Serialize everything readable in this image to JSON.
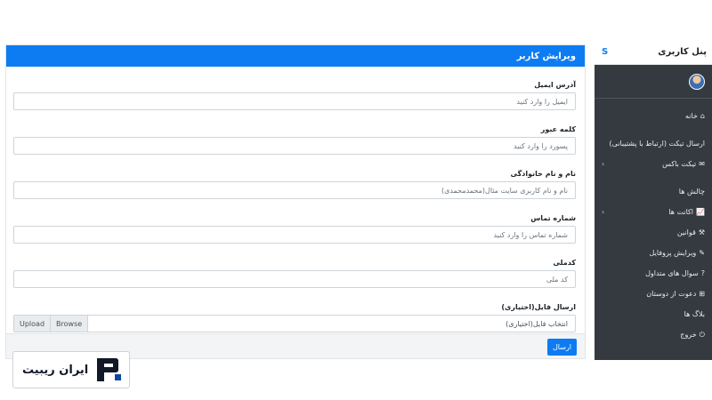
{
  "form": {
    "title": "ویرایش کاربر",
    "fields": [
      {
        "label": "آدرس ایمیل",
        "placeholder": "ایمیل را وارد کنید"
      },
      {
        "label": "کلمه عبور",
        "placeholder": "پسورد را وارد کنید"
      },
      {
        "label": "نام و نام خانوادگی",
        "placeholder": "نام و نام کاربری سایت مثال(محمدمحمدی)"
      },
      {
        "label": "شماره تماس",
        "placeholder": "شماره تماس را وارد کنید"
      },
      {
        "label": "کدملی",
        "placeholder": "کد ملی"
      }
    ],
    "file": {
      "label": "ارسال فایل(اختیاری)",
      "placeholder": "انتخاب فایل(اختیاری)",
      "browse": "Browse",
      "upload": "Upload"
    },
    "submit": "ارسال"
  },
  "sidebar": {
    "title": "پنل کاربری",
    "toggle": "S",
    "items": [
      {
        "label": "خانه",
        "icon": "home-icon",
        "glyph": "⌂"
      },
      {
        "label": "ارسال تیکت (ارتباط با پشتیبانی)",
        "icon": "",
        "glyph": ""
      },
      {
        "label": "تیکت باکس",
        "icon": "envelope-icon",
        "glyph": "✉",
        "chevron": "‹"
      },
      {
        "label": "چالش ها",
        "icon": "",
        "glyph": ""
      },
      {
        "label": "اکانت ها",
        "icon": "chart-icon",
        "glyph": "📈",
        "chevron": "‹"
      },
      {
        "label": "قوانین",
        "icon": "gavel-icon",
        "glyph": "⚒"
      },
      {
        "label": "ویرایش پروفایل",
        "icon": "edit-icon",
        "glyph": "✎"
      },
      {
        "label": "سوال های متداول",
        "icon": "question-icon",
        "glyph": "?"
      },
      {
        "label": "دعوت از دوستان",
        "icon": "gift-icon",
        "glyph": "⊞"
      },
      {
        "label": "بلاگ ها",
        "icon": "",
        "glyph": ""
      },
      {
        "label": "خروج",
        "icon": "power-icon",
        "glyph": "⏻"
      }
    ]
  },
  "logo": {
    "text": "ایران ریبیت"
  },
  "colors": {
    "primary": "#0d7cf2",
    "sidebar": "#343a40"
  }
}
